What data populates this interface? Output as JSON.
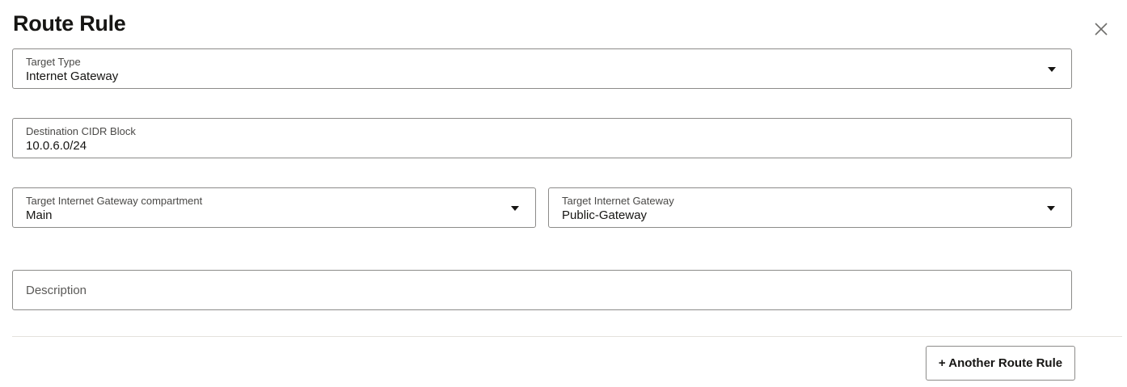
{
  "dialog": {
    "title": "Route Rule",
    "close_icon": "close-icon"
  },
  "target_type": {
    "label": "Target Type",
    "value": "Internet Gateway",
    "icon": "caret-down-icon"
  },
  "destination_cidr": {
    "label": "Destination CIDR Block",
    "value": "10.0.6.0/24"
  },
  "gateway_compartment": {
    "label": "Target Internet Gateway compartment",
    "value": "Main",
    "icon": "caret-down-icon"
  },
  "internet_gateway": {
    "label": "Target Internet Gateway",
    "value": "Public-Gateway",
    "icon": "caret-down-icon"
  },
  "description": {
    "placeholder": "Description",
    "value": ""
  },
  "footer": {
    "add_button_label": "+ Another Route Rule"
  }
}
